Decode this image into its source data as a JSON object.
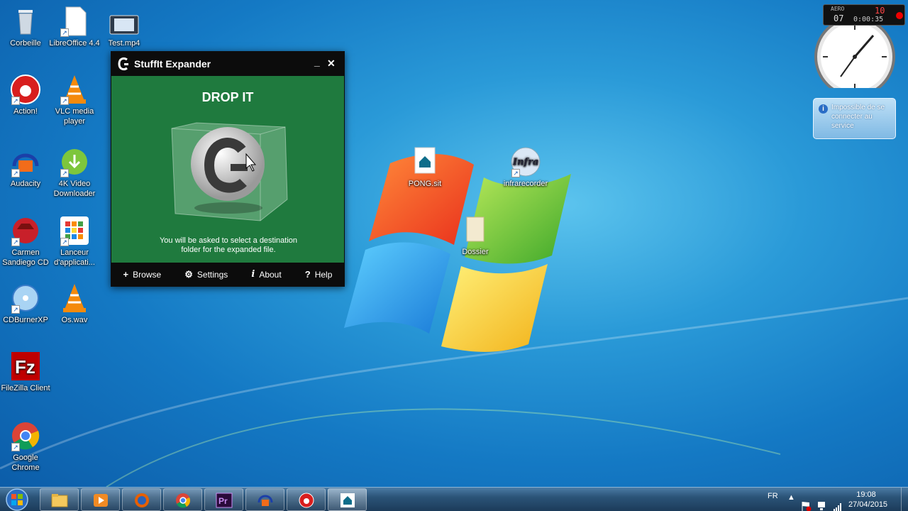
{
  "desktop": {
    "icons": [
      {
        "label": "Corbeille",
        "icon": "recycle-bin-icon"
      },
      {
        "label": "LibreOffice 4.4",
        "icon": "libreoffice-icon"
      },
      {
        "label": "Test.mp4",
        "icon": "video-file-icon"
      },
      {
        "label": "Action!",
        "icon": "action-recorder-icon"
      },
      {
        "label": "VLC media player",
        "icon": "vlc-icon"
      },
      {
        "label": "Audacity",
        "icon": "audacity-icon"
      },
      {
        "label": "4K Video Downloader",
        "icon": "video-downloader-icon"
      },
      {
        "label": "Carmen Sandiego CD",
        "icon": "carmen-sandiego-icon"
      },
      {
        "label": "Lanceur d'applicati...",
        "icon": "app-launcher-icon"
      },
      {
        "label": "CDBurnerXP",
        "icon": "cdburner-icon"
      },
      {
        "label": "Os.wav",
        "icon": "audio-file-icon"
      },
      {
        "label": "FileZilla Client",
        "icon": "filezilla-icon"
      },
      {
        "label": "Google Chrome",
        "icon": "chrome-icon"
      },
      {
        "label": "PONG.sit",
        "icon": "stuffit-archive-icon"
      },
      {
        "label": "infrarecorder",
        "icon": "infrarecorder-icon"
      },
      {
        "label": "Dossier",
        "icon": "folder-icon"
      }
    ]
  },
  "stuffit": {
    "title": "StuffIt Expander",
    "minimize": "_",
    "close": "✕",
    "drop_title": "DROP IT",
    "hint_line1": "You will be asked to select a destination",
    "hint_line2": "folder for the expanded file.",
    "buttons": {
      "browse": "Browse",
      "settings": "Settings",
      "about": "About",
      "help": "Help"
    },
    "accent": "#1f7a3e"
  },
  "gadgets": {
    "recorder_label": "AERO",
    "recorder_fps": "07",
    "recorder_count": "10",
    "recorder_time": "0:00:35",
    "notice": "Impossible de se connecter au service"
  },
  "taskbar": {
    "language": "FR",
    "time": "19:08",
    "date": "27/04/2015",
    "apps": [
      "file-explorer-icon",
      "media-player-icon",
      "firefox-icon",
      "chrome-icon",
      "premiere-icon",
      "audacity-icon",
      "action-recorder-icon",
      "stuffit-icon"
    ]
  }
}
